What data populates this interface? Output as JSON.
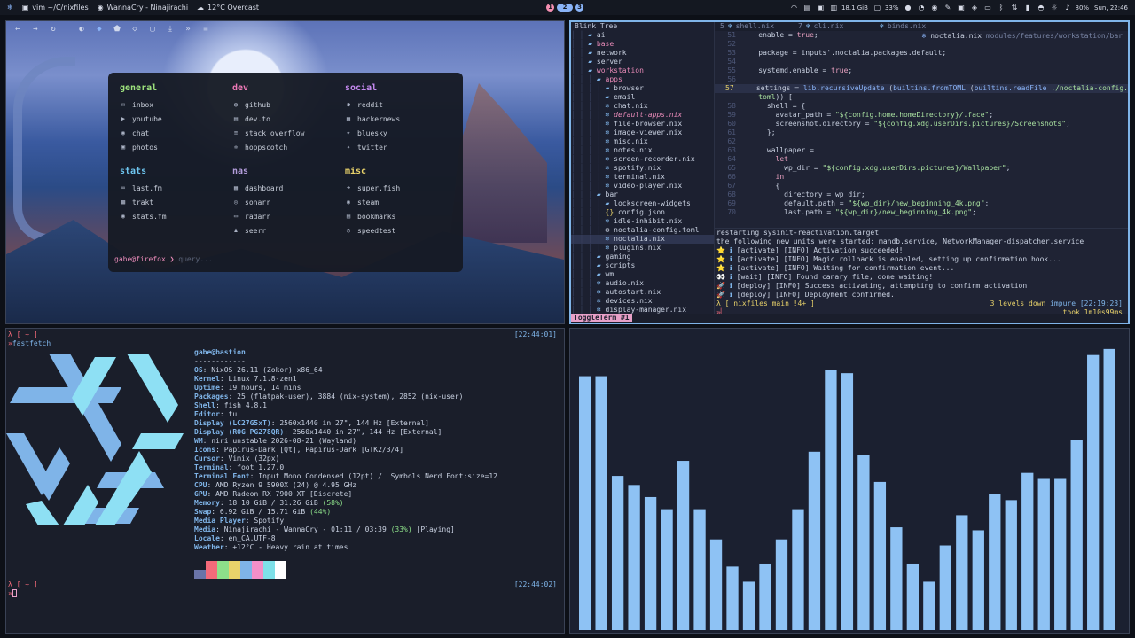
{
  "topbar": {
    "window_title": "vim ~/C/nixfiles",
    "media": "WannaCry - Ninajirachi",
    "weather": "12°C Overcast",
    "workspaces": [
      {
        "label": "1",
        "color": "#f48fb1"
      },
      {
        "label": "2",
        "color": "#8ab4f8"
      },
      {
        "label": "3",
        "color": "#8ab4f8"
      }
    ],
    "ram": "18.1 GiB",
    "cpu": "33%",
    "battery": "80%",
    "clock": "Sun, 22:46"
  },
  "browser": {
    "sections": [
      {
        "title": "general",
        "color": "#9ee37d",
        "links": [
          {
            "icon": "mail-icon",
            "glyph": "✉",
            "label": "inbox"
          },
          {
            "icon": "youtube-icon",
            "glyph": "▶",
            "label": "youtube"
          },
          {
            "icon": "chat-icon",
            "glyph": "◉",
            "label": "chat"
          },
          {
            "icon": "photos-icon",
            "glyph": "▣",
            "label": "photos"
          }
        ]
      },
      {
        "title": "dev",
        "color": "#f07ab8",
        "links": [
          {
            "icon": "github-icon",
            "glyph": "◍",
            "label": "github"
          },
          {
            "icon": "devto-icon",
            "glyph": "▤",
            "label": "dev.to"
          },
          {
            "icon": "stack-overflow-icon",
            "glyph": "≡",
            "label": "stack overflow"
          },
          {
            "icon": "hoppscotch-icon",
            "glyph": "✲",
            "label": "hoppscotch"
          }
        ]
      },
      {
        "title": "social",
        "color": "#c58af0",
        "links": [
          {
            "icon": "reddit-icon",
            "glyph": "◕",
            "label": "reddit"
          },
          {
            "icon": "hackernews-icon",
            "glyph": "▦",
            "label": "hackernews"
          },
          {
            "icon": "bluesky-icon",
            "glyph": "✈",
            "label": "bluesky"
          },
          {
            "icon": "twitter-icon",
            "glyph": "✦",
            "label": "twitter"
          }
        ]
      },
      {
        "title": "stats",
        "color": "#6ec6f0",
        "links": [
          {
            "icon": "lastfm-icon",
            "glyph": "∞",
            "label": "last.fm"
          },
          {
            "icon": "trakt-icon",
            "glyph": "▩",
            "label": "trakt"
          },
          {
            "icon": "statsfm-icon",
            "glyph": "◉",
            "label": "stats.fm"
          }
        ]
      },
      {
        "title": "nas",
        "color": "#b39ddb",
        "links": [
          {
            "icon": "dashboard-icon",
            "glyph": "▦",
            "label": "dashboard"
          },
          {
            "icon": "sonarr-icon",
            "glyph": "◎",
            "label": "sonarr"
          },
          {
            "icon": "radarr-icon",
            "glyph": "▭",
            "label": "radarr"
          },
          {
            "icon": "seerr-icon",
            "glyph": "♟",
            "label": "seerr"
          }
        ]
      },
      {
        "title": "misc",
        "color": "#e8d26a",
        "links": [
          {
            "icon": "superfish-icon",
            "glyph": "➜",
            "label": "super.fish"
          },
          {
            "icon": "steam-icon",
            "glyph": "◉",
            "label": "steam"
          },
          {
            "icon": "bookmarks-icon",
            "glyph": "▤",
            "label": "bookmarks"
          },
          {
            "icon": "speedtest-icon",
            "glyph": "◔",
            "label": "speedtest"
          }
        ]
      }
    ],
    "prompt_user": "gabe@firefox",
    "prompt_arrow": "❯",
    "query_placeholder": "query..."
  },
  "nvim": {
    "tree_title": "Blink Tree",
    "tree": [
      {
        "depth": 3,
        "type": "dir",
        "name": "ai",
        "color": "#c8d0e0"
      },
      {
        "depth": 3,
        "type": "dir",
        "name": "base",
        "color": "#e88ab8"
      },
      {
        "depth": 3,
        "type": "dir",
        "name": "network",
        "color": "#c8d0e0"
      },
      {
        "depth": 3,
        "type": "dir",
        "name": "server",
        "color": "#c8d0e0"
      },
      {
        "depth": 3,
        "type": "dir",
        "name": "workstation",
        "color": "#e88ab8"
      },
      {
        "depth": 4,
        "type": "dir",
        "name": "apps",
        "color": "#e88ab8"
      },
      {
        "depth": 5,
        "type": "dir",
        "name": "browser",
        "color": "#c8d0e0"
      },
      {
        "depth": 5,
        "type": "dir",
        "name": "email",
        "color": "#c8d0e0"
      },
      {
        "depth": 5,
        "type": "nix",
        "name": "chat.nix",
        "color": "#c8d0e0"
      },
      {
        "depth": 5,
        "type": "nix",
        "name": "default-apps.nix",
        "color": "#e88ab8",
        "italic": true
      },
      {
        "depth": 5,
        "type": "nix",
        "name": "file-browser.nix",
        "color": "#c8d0e0"
      },
      {
        "depth": 5,
        "type": "nix",
        "name": "image-viewer.nix",
        "color": "#c8d0e0"
      },
      {
        "depth": 5,
        "type": "nix",
        "name": "misc.nix",
        "color": "#c8d0e0"
      },
      {
        "depth": 5,
        "type": "nix",
        "name": "notes.nix",
        "color": "#c8d0e0"
      },
      {
        "depth": 5,
        "type": "nix",
        "name": "screen-recorder.nix",
        "color": "#c8d0e0"
      },
      {
        "depth": 5,
        "type": "nix",
        "name": "spotify.nix",
        "color": "#c8d0e0"
      },
      {
        "depth": 5,
        "type": "nix",
        "name": "terminal.nix",
        "color": "#c8d0e0"
      },
      {
        "depth": 5,
        "type": "nix",
        "name": "video-player.nix",
        "color": "#c8d0e0"
      },
      {
        "depth": 4,
        "type": "dir",
        "name": "bar",
        "color": "#c8d0e0"
      },
      {
        "depth": 5,
        "type": "dir",
        "name": "lockscreen-widgets",
        "color": "#c8d0e0"
      },
      {
        "depth": 5,
        "type": "json",
        "name": "config.json",
        "color": "#c8d0e0"
      },
      {
        "depth": 5,
        "type": "nix",
        "name": "idle-inhibit.nix",
        "color": "#c8d0e0"
      },
      {
        "depth": 5,
        "type": "toml",
        "name": "noctalia-config.toml",
        "color": "#c8d0e0"
      },
      {
        "depth": 5,
        "type": "nix",
        "name": "noctalia.nix",
        "color": "#c8d0e0",
        "selected": true
      },
      {
        "depth": 5,
        "type": "nix",
        "name": "plugins.nix",
        "color": "#c8d0e0"
      },
      {
        "depth": 4,
        "type": "dir",
        "name": "gaming",
        "color": "#c8d0e0"
      },
      {
        "depth": 4,
        "type": "dir",
        "name": "scripts",
        "color": "#c8d0e0"
      },
      {
        "depth": 4,
        "type": "dir",
        "name": "wm",
        "color": "#c8d0e0"
      },
      {
        "depth": 4,
        "type": "nix",
        "name": "audio.nix",
        "color": "#c8d0e0"
      },
      {
        "depth": 4,
        "type": "nix",
        "name": "autostart.nix",
        "color": "#c8d0e0"
      },
      {
        "depth": 4,
        "type": "nix",
        "name": "devices.nix",
        "color": "#c8d0e0"
      },
      {
        "depth": 4,
        "type": "nix",
        "name": "display-manager.nix",
        "color": "#c8d0e0"
      }
    ],
    "tabs": [
      {
        "num": "5",
        "name": "shell.nix"
      },
      {
        "num": "7",
        "name": "cli.nix"
      },
      {
        "num": "",
        "name": "binds.nix"
      }
    ],
    "winbar_file": "noctalia.nix",
    "winbar_path": "modules/features/workstation/bar",
    "code": [
      {
        "n": "51",
        "parts": [
          [
            "    ",
            "#c8d0e0"
          ],
          [
            "enable",
            "#c8d0e0"
          ],
          [
            " = ",
            "#c8d0e0"
          ],
          [
            "true",
            "#e8a0c0"
          ],
          [
            ";",
            "#c8d0e0"
          ]
        ]
      },
      {
        "n": "52",
        "parts": []
      },
      {
        "n": "53",
        "parts": [
          [
            "    package",
            "#c8d0e0"
          ],
          [
            " = ",
            "#c8d0e0"
          ],
          [
            "inputs'.noctalia.packages.default",
            "#c8d0e0"
          ],
          [
            ";",
            "#c8d0e0"
          ]
        ]
      },
      {
        "n": "54",
        "parts": []
      },
      {
        "n": "55",
        "parts": [
          [
            "    systemd.enable",
            "#c8d0e0"
          ],
          [
            " = ",
            "#c8d0e0"
          ],
          [
            "true",
            "#e8a0c0"
          ],
          [
            ";",
            "#c8d0e0"
          ]
        ]
      },
      {
        "n": "56",
        "parts": []
      },
      {
        "n": "57",
        "current": true,
        "parts": [
          [
            "    settings",
            "#c8d0e0"
          ],
          [
            " = ",
            "#c8d0e0"
          ],
          [
            "lib.recursiveUpdate",
            "#8ab4f8"
          ],
          [
            " (",
            "#c8d0e0"
          ],
          [
            "builtins.fromTOML",
            "#8ab4f8"
          ],
          [
            " (",
            "#c8d0e0"
          ],
          [
            "builtins.readFile",
            "#8ab4f8"
          ],
          [
            " ./noctalia-config.",
            "#a8e0a0"
          ]
        ]
      },
      {
        "n": "",
        "parts": [
          [
            "    toml",
            "#a8e0a0"
          ],
          [
            ")) [",
            "#c8d0e0"
          ]
        ]
      },
      {
        "n": "58",
        "parts": [
          [
            "      shell",
            "#c8d0e0"
          ],
          [
            " = {",
            "#c8d0e0"
          ]
        ]
      },
      {
        "n": "59",
        "parts": [
          [
            "        avatar_path",
            "#c8d0e0"
          ],
          [
            " = ",
            "#c8d0e0"
          ],
          [
            "\"${config.home.homeDirectory}/.face\"",
            "#a8e0a0"
          ],
          [
            ";",
            "#c8d0e0"
          ]
        ]
      },
      {
        "n": "60",
        "parts": [
          [
            "        screenshot.directory",
            "#c8d0e0"
          ],
          [
            " = ",
            "#c8d0e0"
          ],
          [
            "\"${config.xdg.userDirs.pictures}/Screenshots\"",
            "#a8e0a0"
          ],
          [
            ";",
            "#c8d0e0"
          ]
        ]
      },
      {
        "n": "61",
        "parts": [
          [
            "      };",
            "#c8d0e0"
          ]
        ]
      },
      {
        "n": "62",
        "parts": []
      },
      {
        "n": "63",
        "parts": [
          [
            "      wallpaper",
            "#c8d0e0"
          ],
          [
            " =",
            "#c8d0e0"
          ]
        ]
      },
      {
        "n": "64",
        "parts": [
          [
            "        let",
            "#e8a0c0"
          ]
        ]
      },
      {
        "n": "65",
        "parts": [
          [
            "          wp_dir",
            "#c8d0e0"
          ],
          [
            " = ",
            "#c8d0e0"
          ],
          [
            "\"${config.xdg.userDirs.pictures}/Wallpaper\"",
            "#a8e0a0"
          ],
          [
            ";",
            "#c8d0e0"
          ]
        ]
      },
      {
        "n": "66",
        "parts": [
          [
            "        in",
            "#e8a0c0"
          ]
        ]
      },
      {
        "n": "67",
        "parts": [
          [
            "        {",
            "#c8d0e0"
          ]
        ]
      },
      {
        "n": "68",
        "parts": [
          [
            "          directory",
            "#c8d0e0"
          ],
          [
            " = wp_dir;",
            "#c8d0e0"
          ]
        ]
      },
      {
        "n": "69",
        "parts": [
          [
            "          default.path",
            "#c8d0e0"
          ],
          [
            " = ",
            "#c8d0e0"
          ],
          [
            "\"${wp_dir}/new_beginning_4k.png\"",
            "#a8e0a0"
          ],
          [
            ";",
            "#c8d0e0"
          ]
        ]
      },
      {
        "n": "70",
        "parts": [
          [
            "          last.path",
            "#c8d0e0"
          ],
          [
            " = ",
            "#c8d0e0"
          ],
          [
            "\"${wp_dir}/new_beginning_4k.png\"",
            "#a8e0a0"
          ],
          [
            ";",
            "#c8d0e0"
          ]
        ]
      }
    ],
    "term_lines": [
      {
        "pre": "",
        "text": "restarting sysinit-reactivation.target",
        "color": "#c8d0e0"
      },
      {
        "pre": "",
        "text": "the following new units were started: mandb.service, NetworkManager-dispatcher.service",
        "color": "#c8d0e0"
      },
      {
        "pre": "⭐ ",
        "tag": "[activate]",
        "text": " [INFO] Activation succeeded!",
        "color": "#c8d0e0"
      },
      {
        "pre": "⭐ ",
        "tag": "[activate]",
        "text": " [INFO] Magic rollback is enabled, setting up confirmation hook...",
        "color": "#c8d0e0"
      },
      {
        "pre": "⭐ ",
        "tag": "[activate]",
        "text": " [INFO] Waiting for confirmation event...",
        "color": "#c8d0e0"
      },
      {
        "pre": "👀 ",
        "tag": "[wait]",
        "text": " [INFO] Found canary file, done waiting!",
        "color": "#c8d0e0"
      },
      {
        "pre": "🚀 ",
        "tag": "[deploy]",
        "text": " [INFO] Success activating, attempting to confirm activation",
        "color": "#c8d0e0"
      },
      {
        "pre": "🚀 ",
        "tag": "[deploy]",
        "text": " [INFO] Deployment confirmed.",
        "color": "#c8d0e0"
      }
    ],
    "term_prompt": "λ [ nixfiles main !4+ ]",
    "term_right": "3 levels down",
    "term_right2": "impure [22:19:23]",
    "term_took": "took 1m10s99ms",
    "toggle_label": "ToggleTerm #1"
  },
  "fastfetch": {
    "prompt": "λ [ ~ ]",
    "time1": "[22:44:01]",
    "command": "fastfetch",
    "user_host": "gabe@bastion",
    "divider": "------------",
    "info": [
      {
        "k": "OS",
        "v": "NixOS 26.11 (Zokor) x86_64"
      },
      {
        "k": "Kernel",
        "v": "Linux 7.1.8-zen1"
      },
      {
        "k": "Uptime",
        "v": "19 hours, 14 mins"
      },
      {
        "k": "Packages",
        "v": "25 (flatpak-user), 3884 (nix-system), 2852 (nix-user)"
      },
      {
        "k": "Shell",
        "v": "fish 4.8.1"
      },
      {
        "k": "Editor",
        "v": "tu"
      },
      {
        "k": "Display (LC27G5xT)",
        "v": "2560x1440 in 27\", 144 Hz [External]"
      },
      {
        "k": "Display (ROG PG278QR)",
        "v": "2560x1440 in 27\", 144 Hz [External]"
      },
      {
        "k": "WM",
        "v": "niri unstable 2026-08-21 (Wayland)"
      },
      {
        "k": "Icons",
        "v": "Papirus-Dark [Qt], Papirus-Dark [GTK2/3/4]"
      },
      {
        "k": "Cursor",
        "v": "Vimix (32px)"
      },
      {
        "k": "Terminal",
        "v": "foot 1.27.0"
      },
      {
        "k": "Terminal Font",
        "v": "Input Mono Condensed (12pt) /  Symbols Nerd Font:size=12"
      },
      {
        "k": "CPU",
        "v": "AMD Ryzen 9 5900X (24) @ 4.95 GHz"
      },
      {
        "k": "GPU",
        "v": "AMD Radeon RX 7900 XT [Discrete]"
      },
      {
        "k": "Memory",
        "v": "18.10 GiB / 31.26 GiB",
        "pct": "(58%)"
      },
      {
        "k": "Swap",
        "v": "6.92 GiB / 15.71 GiB",
        "pct": "(44%)"
      },
      {
        "k": "Media Player",
        "v": "Spotify"
      },
      {
        "k": "Media",
        "v": "Ninajirachi - WannaCry - 01:11 / 03:39",
        "pct": "(33%)",
        "tail": " [Playing]"
      },
      {
        "k": "Locale",
        "v": "en_CA.UTF-8"
      },
      {
        "k": "Weather",
        "v": "+12°C - Heavy rain at times"
      }
    ],
    "swatches": [
      "#6a74a8",
      "#f46a7a",
      "#8de08a",
      "#e8d26a",
      "#7fb4e8",
      "#f48fc8",
      "#7ee0e8",
      "#ffffff"
    ],
    "time2": "[22:44:02]",
    "prompt2": "λ [ ~ ]"
  },
  "visualizer": {
    "bar_color": "#8ec2f4",
    "levels": [
      0.84,
      0.84,
      0.51,
      0.48,
      0.44,
      0.4,
      0.56,
      0.4,
      0.3,
      0.21,
      0.16,
      0.22,
      0.3,
      0.4,
      0.59,
      0.86,
      0.85,
      0.58,
      0.49,
      0.34,
      0.22,
      0.16,
      0.28,
      0.38,
      0.33,
      0.45,
      0.43,
      0.52,
      0.5,
      0.5,
      0.63,
      0.91,
      0.93
    ]
  }
}
